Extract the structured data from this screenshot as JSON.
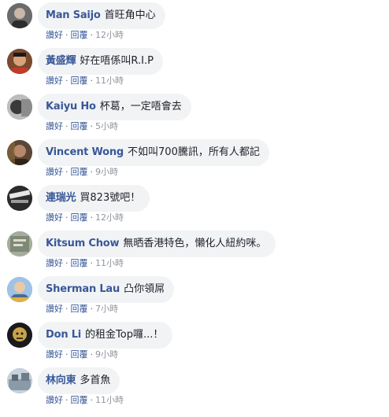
{
  "labels": {
    "like": "讚好",
    "reply": "回覆",
    "dot": "·"
  },
  "comments": [
    {
      "author": "Man Saijo",
      "text": "首旺角中心",
      "time": "12小時"
    },
    {
      "author": "黃盛輝",
      "text": "好在唔係叫R.I.P",
      "time": "11小時"
    },
    {
      "author": "Kaiyu Ho",
      "text": "杯葛，一定唔會去",
      "time": "5小時"
    },
    {
      "author": "Vincent Wong",
      "text": "不如叫700騰訊，所有人都記",
      "time": "9小時"
    },
    {
      "author": "連瑞光",
      "text": "買823號吧！",
      "time": "12小時"
    },
    {
      "author": "Kitsum Chow",
      "text": "無晒香港特色，懶化人紐約咪。",
      "time": "11小時"
    },
    {
      "author": "Sherman Lau",
      "text": "凸你領屌",
      "time": "7小時"
    },
    {
      "author": "Don Li",
      "text": "的租金Top囉...！",
      "time": "9小時"
    },
    {
      "author": "林向東",
      "text": "多首魚",
      "time": "11小時"
    }
  ],
  "avatar_colors": [
    "#6b6b6b",
    "#7a4a2e",
    "#3a3a3a",
    "#5a4636",
    "#2b2b2b",
    "#7f8a76",
    "#4e6a8e",
    "#3b3320",
    "#8a9aa8"
  ],
  "accent_color": "#385898"
}
